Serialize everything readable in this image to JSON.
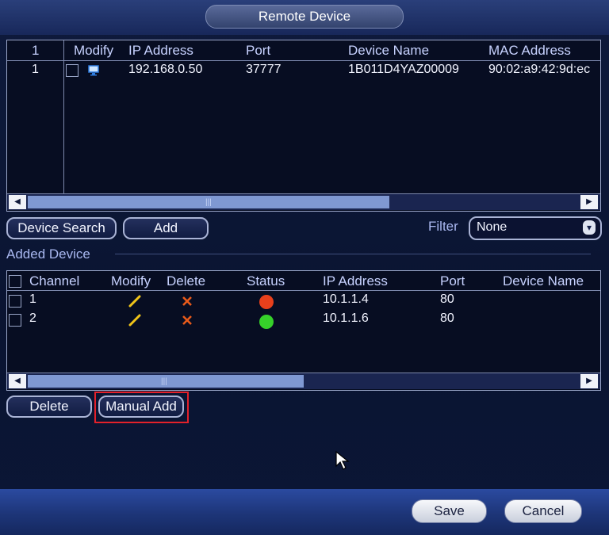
{
  "window": {
    "title": "Remote Device"
  },
  "search_table": {
    "headers": [
      "1",
      "Modify",
      "IP Address",
      "Port",
      "Device Name",
      "MAC Address"
    ],
    "rows": [
      {
        "index": "1",
        "ip": "192.168.0.50",
        "port": "37777",
        "name": "1B011D4YAZ00009",
        "mac": "90:02:a9:42:9d:ec"
      }
    ]
  },
  "controls": {
    "device_search": "Device Search",
    "add": "Add",
    "filter_label": "Filter",
    "filter_value": "None"
  },
  "added_device": {
    "section_title": "Added Device",
    "headers": [
      "Channel",
      "Modify",
      "Delete",
      "Status",
      "IP Address",
      "Port",
      "Device Name"
    ],
    "rows": [
      {
        "channel": "1",
        "ip": "10.1.1.4",
        "port": "80",
        "status_color": "#e8401c"
      },
      {
        "channel": "2",
        "ip": "10.1.1.6",
        "port": "80",
        "status_color": "#36d12a"
      }
    ]
  },
  "bottom_buttons": {
    "delete": "Delete",
    "manual_add": "Manual Add"
  },
  "footer": {
    "save": "Save",
    "cancel": "Cancel"
  },
  "icons": {
    "modify": "pencil-icon",
    "delete": "x-icon",
    "device_type": "monitor-icon",
    "cursor": "mouse-pointer-icon",
    "scroll_left": "triangle-left-icon",
    "scroll_right": "triangle-right-icon",
    "dropdown": "chevron-down-icon"
  },
  "colors": {
    "highlight_box": "#e3212a",
    "modify_pencil": "#f0c419",
    "delete_x": "#e85a1a"
  }
}
